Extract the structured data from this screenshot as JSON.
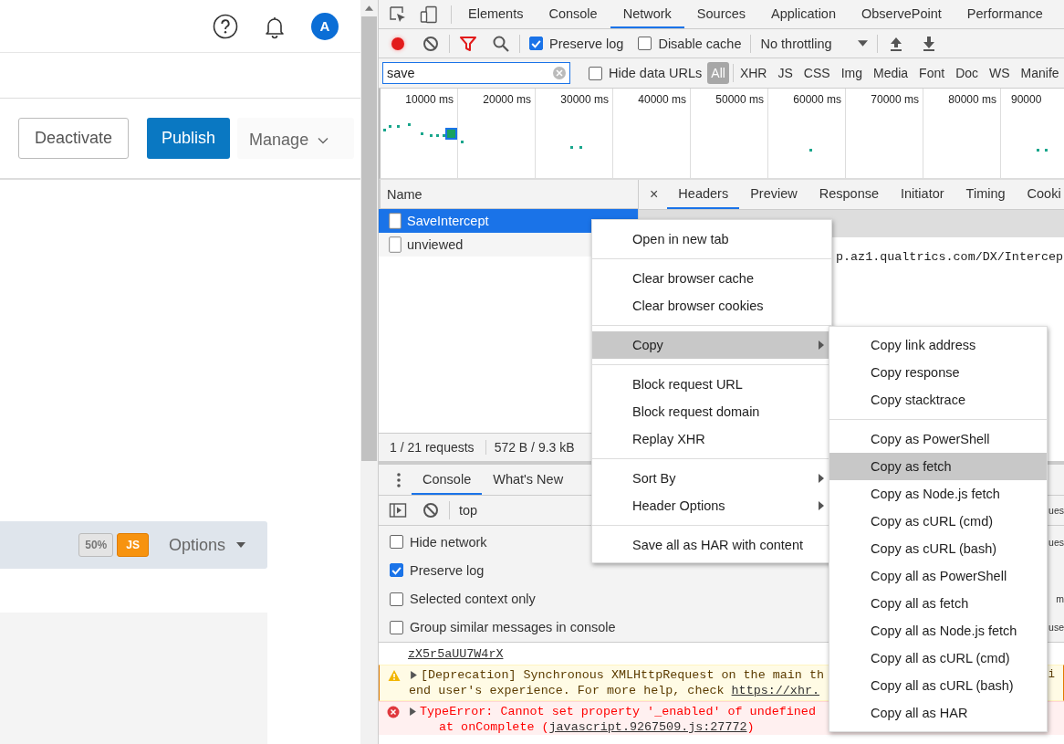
{
  "page": {
    "avatar": "A",
    "actions": [
      {
        "label": "Deactivate",
        "kind": "outline"
      },
      {
        "label": "Publish",
        "kind": "primary"
      },
      {
        "label": "Manage",
        "kind": "dropdown"
      }
    ],
    "question_bar": {
      "badges": [
        {
          "label": "50%",
          "kind": "neutral"
        },
        {
          "label": "JS",
          "kind": "warning"
        }
      ],
      "menu": "Options"
    }
  },
  "devtools": {
    "panels": [
      {
        "label": "Elements",
        "selected": false
      },
      {
        "label": "Console",
        "selected": false
      },
      {
        "label": "Network",
        "selected": true
      },
      {
        "label": "Sources",
        "selected": false
      },
      {
        "label": "Application",
        "selected": false
      },
      {
        "label": "ObservePoint",
        "selected": false
      },
      {
        "label": "Performance",
        "selected": false
      }
    ],
    "toolbar": {
      "recording": true,
      "options": [
        {
          "label": "Preserve log",
          "checked": true
        },
        {
          "label": "Disable cache",
          "checked": false
        }
      ],
      "throttling": "No throttling"
    },
    "filter": {
      "value": "save",
      "hide_data_urls": {
        "label": "Hide data URLs",
        "checked": false
      },
      "types": [
        {
          "label": "All",
          "selected": true
        },
        {
          "label": "XHR",
          "selected": false
        },
        {
          "label": "JS",
          "selected": false
        },
        {
          "label": "CSS",
          "selected": false
        },
        {
          "label": "Img",
          "selected": false
        },
        {
          "label": "Media",
          "selected": false
        },
        {
          "label": "Font",
          "selected": false
        },
        {
          "label": "Doc",
          "selected": false
        },
        {
          "label": "WS",
          "selected": false
        },
        {
          "label": "Manife",
          "selected": false
        }
      ]
    },
    "overview_ticks": [
      "10000 ms",
      "20000 ms",
      "30000 ms",
      "40000 ms",
      "50000 ms",
      "60000 ms",
      "70000 ms",
      "80000 ms",
      "90000"
    ],
    "requests": {
      "column": "Name",
      "rows": [
        {
          "name": "SaveIntercept",
          "selected": true
        },
        {
          "name": "unviewed",
          "selected": false
        }
      ],
      "summary": [
        "1 / 21 requests",
        "572 B / 9.3 kB"
      ]
    },
    "detail": {
      "close": "×",
      "tabs": [
        {
          "label": "Headers",
          "selected": true
        },
        {
          "label": "Preview",
          "selected": false
        },
        {
          "label": "Response",
          "selected": false
        },
        {
          "label": "Initiator",
          "selected": false
        },
        {
          "label": "Timing",
          "selected": false
        },
        {
          "label": "Cooki",
          "selected": false
        }
      ],
      "url_fragment": "p.az1.qualtrics.com/DX/Intercep"
    },
    "drawer": {
      "tabs": [
        {
          "label": "Console",
          "selected": true
        },
        {
          "label": "What's New",
          "selected": false
        }
      ],
      "context": "top",
      "toolbar_fragment": "ues",
      "settings": [
        {
          "label": "Hide network",
          "checked": false,
          "fragment": "ues"
        },
        {
          "label": "Preserve log",
          "checked": true
        },
        {
          "label": "Selected context only",
          "checked": false,
          "fragment": "m"
        },
        {
          "label": "Group similar messages in console",
          "checked": false,
          "fragment": "use"
        }
      ],
      "messages": [
        {
          "kind": "link",
          "link": "zX5r5aUU7W4rX"
        },
        {
          "kind": "warning",
          "text": "[Deprecation] Synchronous XMLHttpRequest on the main th",
          "tail": "i",
          "text2": "end user's experience. For more help, check ",
          "link": "https://xhr."
        },
        {
          "kind": "error",
          "text": "TypeError: Cannot set property '_enabled' of undefined",
          "text2": "at onComplete (",
          "link": "javascript.9267509.js:27772",
          "text3": ")"
        }
      ]
    }
  },
  "context_menu": {
    "items": [
      {
        "kind": "item",
        "label": "Open in new tab",
        "selected": false
      },
      {
        "kind": "separator"
      },
      {
        "kind": "item",
        "label": "Clear browser cache",
        "selected": false
      },
      {
        "kind": "item",
        "label": "Clear browser cookies",
        "selected": false
      },
      {
        "kind": "separator"
      },
      {
        "kind": "submenu",
        "label": "Copy",
        "selected": true
      },
      {
        "kind": "separator"
      },
      {
        "kind": "item",
        "label": "Block request URL",
        "selected": false
      },
      {
        "kind": "item",
        "label": "Block request domain",
        "selected": false
      },
      {
        "kind": "item",
        "label": "Replay XHR",
        "selected": false
      },
      {
        "kind": "separator"
      },
      {
        "kind": "submenu",
        "label": "Sort By",
        "selected": false
      },
      {
        "kind": "submenu",
        "label": "Header Options",
        "selected": false
      },
      {
        "kind": "separator"
      },
      {
        "kind": "item",
        "label": "Save all as HAR with content",
        "selected": false
      }
    ]
  },
  "copy_submenu": {
    "items": [
      {
        "kind": "item",
        "label": "Copy link address",
        "selected": false
      },
      {
        "kind": "item",
        "label": "Copy response",
        "selected": false
      },
      {
        "kind": "item",
        "label": "Copy stacktrace",
        "selected": false
      },
      {
        "kind": "separator"
      },
      {
        "kind": "item",
        "label": "Copy as PowerShell",
        "selected": false
      },
      {
        "kind": "item",
        "label": "Copy as fetch",
        "selected": true
      },
      {
        "kind": "item",
        "label": "Copy as Node.js fetch",
        "selected": false
      },
      {
        "kind": "item",
        "label": "Copy as cURL (cmd)",
        "selected": false
      },
      {
        "kind": "item",
        "label": "Copy as cURL (bash)",
        "selected": false
      },
      {
        "kind": "item",
        "label": "Copy all as PowerShell",
        "selected": false
      },
      {
        "kind": "item",
        "label": "Copy all as fetch",
        "selected": false
      },
      {
        "kind": "item",
        "label": "Copy all as Node.js fetch",
        "selected": false
      },
      {
        "kind": "item",
        "label": "Copy all as cURL (cmd)",
        "selected": false
      },
      {
        "kind": "item",
        "label": "Copy all as cURL (bash)",
        "selected": false
      },
      {
        "kind": "item",
        "label": "Copy all as HAR",
        "selected": false
      }
    ]
  }
}
